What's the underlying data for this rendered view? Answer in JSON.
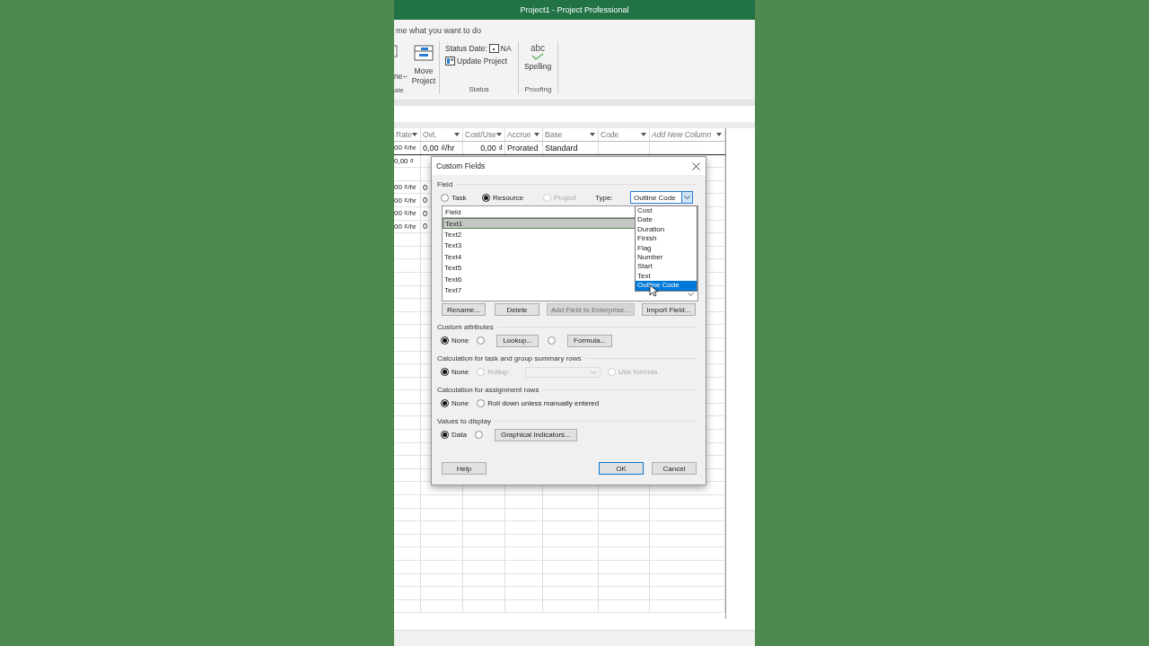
{
  "window": {
    "title": "Project1  -  Project Professional"
  },
  "tell_me": {
    "text": "me what you want to do"
  },
  "ribbon": {
    "groups": [
      {
        "label": "ale",
        "buttons": [
          {
            "kind": "cut",
            "label": "ne",
            "dropdown": true
          },
          {
            "kind": "large",
            "label": "Move Project"
          }
        ]
      },
      {
        "label": "Status",
        "buttons": [
          {
            "kind": "status-date",
            "label": "Status Date:",
            "value": "NA"
          },
          {
            "kind": "small",
            "label": "Update Project"
          }
        ]
      },
      {
        "label": "Proofing",
        "buttons": [
          {
            "kind": "spelling",
            "icon_text": "abc",
            "label": "Spelling"
          }
        ]
      }
    ]
  },
  "table": {
    "columns": [
      {
        "label": "Rate",
        "kind": "field"
      },
      {
        "label": "Ovt.",
        "kind": "field"
      },
      {
        "label": "Cost/Use",
        "kind": "field"
      },
      {
        "label": "Accrue",
        "kind": "field"
      },
      {
        "label": "Base",
        "kind": "field"
      },
      {
        "label": "Code",
        "kind": "field"
      },
      {
        "label": "Add New Column",
        "kind": "add-new"
      }
    ],
    "rows": [
      {
        "rate": "00 ₫/hr",
        "ovt": "0,00 ₫/hr",
        "cost_use": "0,00 ₫",
        "accrue": "Prorated",
        "base": "Standard"
      },
      {
        "rate": "0,00 ₫"
      },
      {},
      {
        "rate": "00 ₫/hr",
        "ovt": "0"
      },
      {
        "rate": "00 ₫/hr",
        "ovt": "0"
      },
      {
        "rate": "00 ₫/hr",
        "ovt": "0"
      },
      {
        "rate": "00 ₫/hr",
        "ovt": "0"
      }
    ]
  },
  "dialog": {
    "title": "Custom Fields",
    "field_label": "Field",
    "scope": [
      {
        "label": "Task",
        "selected": false,
        "disabled": false
      },
      {
        "label": "Resource",
        "selected": true,
        "disabled": false
      },
      {
        "label": "Project",
        "selected": false,
        "disabled": true
      }
    ],
    "type_label": "Type:",
    "type_value": "Outline Code",
    "type_open": true,
    "type_options": [
      {
        "label": "Cost",
        "selected": false
      },
      {
        "label": "Date",
        "selected": false
      },
      {
        "label": "Duration",
        "selected": false
      },
      {
        "label": "Finish",
        "selected": false
      },
      {
        "label": "Flag",
        "selected": false
      },
      {
        "label": "Number",
        "selected": false
      },
      {
        "label": "Start",
        "selected": false
      },
      {
        "label": "Text",
        "selected": false
      },
      {
        "label": "Outline Code",
        "selected": true
      }
    ],
    "list_header": "Field",
    "fields": [
      {
        "label": "Text1",
        "selected": true
      },
      {
        "label": "Text2",
        "selected": false
      },
      {
        "label": "Text3",
        "selected": false
      },
      {
        "label": "Text4",
        "selected": false
      },
      {
        "label": "Text5",
        "selected": false
      },
      {
        "label": "Text6",
        "selected": false
      },
      {
        "label": "Text7",
        "selected": false
      }
    ],
    "field_buttons": [
      {
        "label": "Rename...",
        "disabled": false
      },
      {
        "label": "Delete",
        "disabled": false
      },
      {
        "label": "Add Field to Enterprise...",
        "disabled": true
      },
      {
        "label": "Import Field...",
        "disabled": false
      }
    ],
    "sections": [
      {
        "label": "Custom attributes",
        "options": [
          {
            "kind": "radio",
            "label": "None",
            "selected": true,
            "disabled": false
          },
          {
            "kind": "radio-button",
            "button": "Lookup...",
            "selected": false,
            "disabled": false
          },
          {
            "kind": "radio-button",
            "button": "Formula...",
            "selected": false,
            "disabled": false
          }
        ]
      },
      {
        "label": "Calculation for task and group summary rows",
        "options": [
          {
            "kind": "radio",
            "label": "None",
            "selected": true,
            "disabled": false
          },
          {
            "kind": "radio",
            "label": "Rollup:",
            "selected": false,
            "disabled": true
          },
          {
            "kind": "combo",
            "disabled": true
          },
          {
            "kind": "radio",
            "label": "Use formula",
            "selected": false,
            "disabled": true
          }
        ]
      },
      {
        "label": "Calculation for assignment rows",
        "options": [
          {
            "kind": "radio",
            "label": "None",
            "selected": true,
            "disabled": false
          },
          {
            "kind": "radio",
            "label": "Roll down unless manually entered",
            "selected": false,
            "disabled": false
          }
        ]
      },
      {
        "label": "Values to display",
        "options": [
          {
            "kind": "radio",
            "label": "Data",
            "selected": true,
            "disabled": false
          },
          {
            "kind": "radio-button",
            "button": "Graphical Indicators...",
            "selected": false,
            "disabled": false
          }
        ]
      }
    ],
    "footer_buttons": [
      {
        "label": "Help",
        "default": false
      },
      {
        "label": "OK",
        "default": true
      },
      {
        "label": "Cancel",
        "default": false
      }
    ]
  }
}
